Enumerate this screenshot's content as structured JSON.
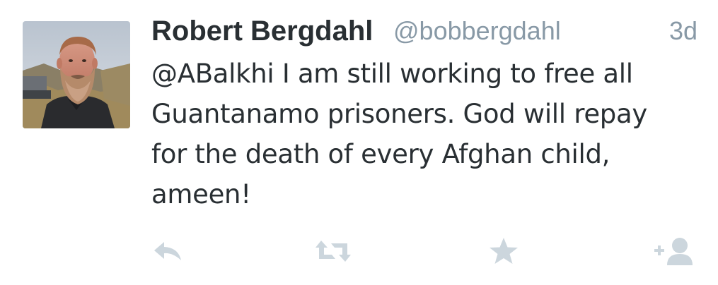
{
  "tweet": {
    "author_name": "Robert Bergdahl",
    "author_handle": "@bobbergdahl",
    "timestamp": "3d",
    "text_lines": [
      "@ABalkhi I am still working to free all",
      "Guantanamo prisoners. God will repay",
      "for the death of every Afghan child,",
      "ameen!"
    ]
  },
  "actions": [
    {
      "icon": "reply-icon"
    },
    {
      "icon": "retweet-icon"
    },
    {
      "icon": "favorite-star-icon"
    },
    {
      "icon": "follow-user-icon"
    }
  ],
  "colors": {
    "text": "#292f33",
    "secondary": "#8899a6",
    "action_icon": "#ccd6dd",
    "background": "#ffffff"
  }
}
